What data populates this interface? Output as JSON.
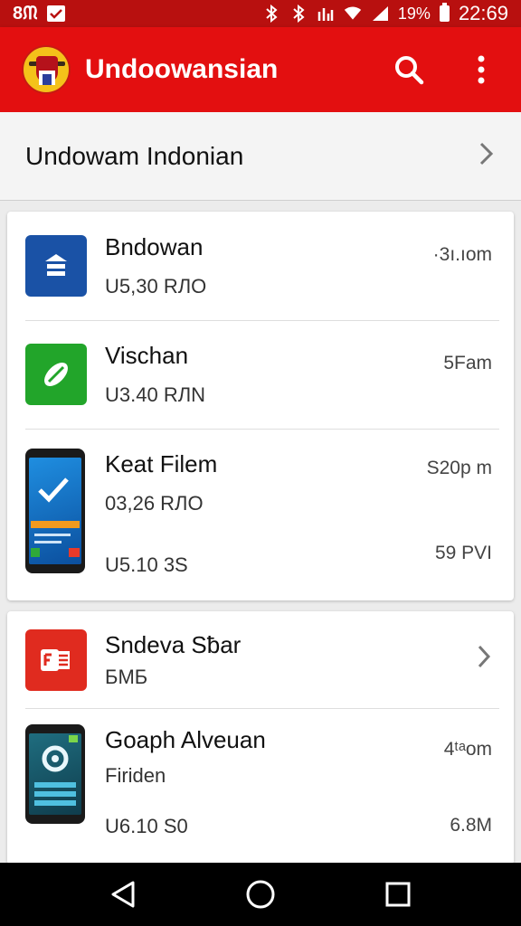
{
  "status_bar": {
    "left_text": "8ᙏ",
    "time": "22:69",
    "battery": "19%"
  },
  "app_bar": {
    "title": "Undoowansian",
    "logo_icon": "emblem-logo",
    "search_icon": "search-icon",
    "menu_icon": "more-vert-icon"
  },
  "header": {
    "label": "Undowam Indonian"
  },
  "card1": {
    "items": [
      {
        "title": "Bndowan",
        "subtitle": "U5,30 RЛO",
        "meta": "·3ı.ıom",
        "icon": "briefcase-icon",
        "color": "#1a52a6"
      },
      {
        "title": "Vischan",
        "subtitle": "U3.40 RЛN",
        "meta": "5Fam",
        "icon": "leaf-icon",
        "color": "#22a52a"
      },
      {
        "title": "Keat Filem",
        "subtitle": "03,26 RЛO",
        "subtitle2": "U5.10 3S",
        "meta": "S20p m",
        "meta2": "59 PVI",
        "icon": "phone-check-icon"
      }
    ]
  },
  "card2": {
    "items": [
      {
        "title": "Sndeva Sƀar",
        "subtitle": "БМБ",
        "icon": "document-icon",
        "color": "#e02b1f"
      },
      {
        "title": "Goaph Alveuan",
        "subtitle": "Firiden",
        "subtitle2": "U6.10 S0",
        "meta": "4ᵗᵃom",
        "meta2": "6.8M",
        "icon": "phone-gear-icon"
      }
    ]
  },
  "nav": {
    "back": "back-icon",
    "home": "home-icon",
    "recents": "recents-icon"
  }
}
